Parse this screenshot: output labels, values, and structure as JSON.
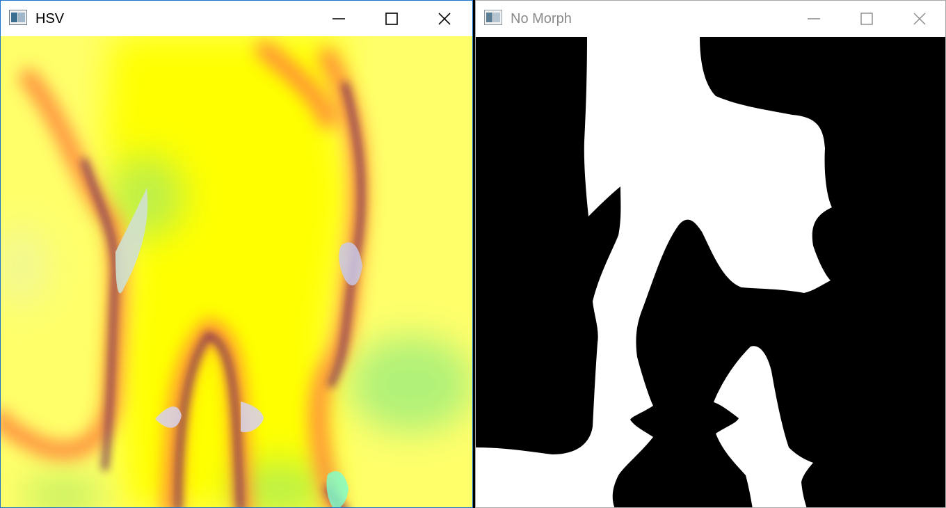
{
  "windows": [
    {
      "title": "HSV",
      "active": true,
      "icon": "app-window-icon",
      "controls": [
        "minimize-icon",
        "maximize-icon",
        "close-icon"
      ],
      "content": "hsv-heatmap-image"
    },
    {
      "title": "No Morph",
      "active": false,
      "icon": "app-window-icon",
      "controls": [
        "minimize-icon",
        "maximize-icon",
        "close-icon"
      ],
      "content": "binary-mask-image"
    }
  ],
  "colors": {
    "active_border": "#1a73c9",
    "inactive_title_text": "#8a8a8a",
    "mask_foreground": "#ffffff",
    "mask_background": "#000000",
    "hsv_base": "#ffff66",
    "hsv_core": "#ffff00",
    "hsv_edge_orange": "#ff8a3a",
    "hsv_edge_dark": "#6a1f5a",
    "hsv_green": "#a8f07a"
  }
}
